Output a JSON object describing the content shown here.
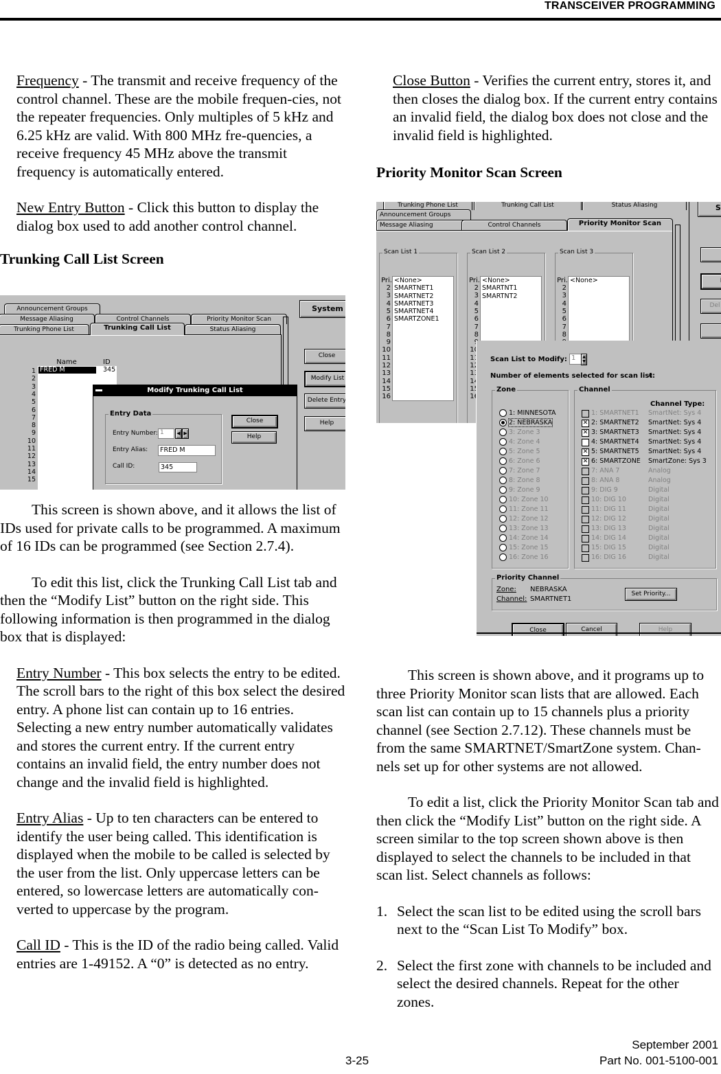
{
  "header": {
    "title": "TRANSCEIVER PROGRAMMING"
  },
  "left": {
    "frequency": {
      "term": "Frequency",
      "text": " - The transmit and receive frequency of the control channel. These are the mobile frequen-cies, not the repeater frequencies. Only multiples of 5 kHz and 6.25 kHz are valid. With 800 MHz fre-quencies, a receive frequency 45 MHz above the transmit frequency is automatically entered."
    },
    "new_entry": {
      "term": "New Entry Button",
      "text": " - Click this button to display the dialog box used to add another control channel."
    },
    "heading": "Trunking Call List Screen",
    "para1": "This screen is shown above, and it allows the list of IDs used for private calls to be programmed. A maximum of 16 IDs can be programmed (see Section 2.7.4).",
    "para2": "To edit this list, click the Trunking Call List tab and then the “Modify List” button on the right side. This following information is then programmed in the dialog box that is displayed:",
    "entry_number": {
      "term": "Entry Number",
      "text": " - This box selects the entry to be edited. The scroll bars to the right of this box select the desired entry. A phone list can contain up to 16 entries. Selecting a new entry number automatically validates and stores the current entry. If the current entry contains an invalid field, the entry number does not change and the invalid field is highlighted."
    },
    "entry_alias": {
      "term": "Entry Alias",
      "text": " - Up to ten characters can be entered to identify the user being called. This identification is displayed when the mobile to be called is selected by the user from the list. Only uppercase letters can be entered, so lowercase letters are automatically con-verted to uppercase by the program."
    },
    "call_id": {
      "term": "Call ID",
      "text": " - This is the ID of the radio being called. Valid entries are 1-49152. A “0” is detected as no entry."
    }
  },
  "right": {
    "close_button": {
      "term": "Close Button",
      "text": " - Verifies the current entry, stores it, and then closes the dialog box. If the current entry contains an invalid field, the dialog box does not close and the invalid field is highlighted."
    },
    "heading": "Priority Monitor Scan Screen",
    "para1": "This screen is shown above, and it programs up to three Priority Monitor scan lists that are allowed. Each scan list can contain up to 15 channels plus a priority channel (see Section 2.7.12). These channels must be from the same SMARTNET/SmartZone system. Chan-nels set up for other systems are not allowed.",
    "para2": "To edit a list, click the Priority Monitor Scan tab and then click the “Modify List” button on the right side. A screen similar to the top screen shown above is then displayed to select the channels to be included in that scan list. Select channels as follows:",
    "steps": [
      {
        "n": "1.",
        "text": "Select the scan list to be edited using the scroll bars next to the “Scan List To Modify” box."
      },
      {
        "n": "2.",
        "text": "Select the first zone with channels to be included and select the desired channels. Repeat for the other zones."
      }
    ]
  },
  "footer": {
    "page": "3-25",
    "date": "September 2001",
    "part": "Part No. 001-5100-001"
  },
  "shot1": {
    "tabs_row1": [
      "Announcement Groups"
    ],
    "tabs_row2": [
      "Message Aliasing",
      "Control Channels",
      "Priority Monitor Scan"
    ],
    "tabs_row3": [
      "Trunking Phone List",
      "Trunking Call List",
      "Status Aliasing"
    ],
    "system_button": "System",
    "col_name": "Name",
    "col_id": "ID",
    "row_numbers": [
      "1",
      "2",
      "3",
      "4",
      "5",
      "6",
      "7",
      "8",
      "9",
      "10",
      "11",
      "12",
      "13",
      "14",
      "15"
    ],
    "first_name": "FRED M",
    "first_id": "345",
    "side_buttons": [
      "Close",
      "Modify List",
      "Delete Entry",
      "Help"
    ],
    "dialog": {
      "title": "Modify Trunking Call List",
      "group": "Entry Data",
      "entry_number_label": "Entry Number:",
      "entry_number_value": "1",
      "entry_alias_label": "Entry Alias:",
      "entry_alias_value": "FRED M",
      "call_id_label": "Call ID:",
      "call_id_value": "345",
      "close": "Close",
      "help": "Help"
    }
  },
  "shot2": {
    "tabs_row1": [
      "Trunking Phone List",
      "Trunking Call List",
      "Status Aliasing"
    ],
    "tabs_row2": [
      "Announcement Groups"
    ],
    "tabs_row3": [
      "Message Aliasing",
      "Control Channels",
      "Priority Monitor Scan"
    ],
    "system_button": "Sy",
    "scan_lists": [
      {
        "title": "Scan List 1",
        "pri": "Pri.",
        "items": [
          "<None>",
          "SMARTNET1",
          "SMARTNET2",
          "SMARTNET3",
          "SMARTNET4",
          "SMARTZONE1"
        ]
      },
      {
        "title": "Scan List 2",
        "pri": "Pri.",
        "items": [
          "<None>",
          "SMARTNT1",
          "SMARTNT2"
        ]
      },
      {
        "title": "Scan List 3",
        "pri": "Pri.",
        "items": [
          "<None>"
        ]
      }
    ],
    "row_numbers": [
      "2",
      "3",
      "4",
      "5",
      "6",
      "7",
      "8",
      "9",
      "10",
      "11",
      "12",
      "13",
      "14",
      "15",
      "16"
    ],
    "side_buttons": [
      "",
      "Mo",
      "Del",
      ""
    ],
    "dialog": {
      "scan_list_label": "Scan List to Modify:",
      "scan_list_value": "1",
      "count_label": "Number of elements selected for scan list:",
      "count_value": "4",
      "zone_group": "Zone",
      "channel_group": "Channel",
      "channel_type_header": "Channel Type:",
      "zones": [
        {
          "label": "1:  MINNESOTA",
          "selected": false,
          "enabled": true
        },
        {
          "label": "2:  NEBRASKA",
          "selected": true,
          "enabled": true
        },
        {
          "label": "3:  Zone 3",
          "selected": false,
          "enabled": false
        },
        {
          "label": "4:  Zone 4",
          "selected": false,
          "enabled": false
        },
        {
          "label": "5:  Zone 5",
          "selected": false,
          "enabled": false
        },
        {
          "label": "6:  Zone 6",
          "selected": false,
          "enabled": false
        },
        {
          "label": "7:  Zone 7",
          "selected": false,
          "enabled": false
        },
        {
          "label": "8:  Zone 8",
          "selected": false,
          "enabled": false
        },
        {
          "label": "9:  Zone 9",
          "selected": false,
          "enabled": false
        },
        {
          "label": "10:  Zone 10",
          "selected": false,
          "enabled": false
        },
        {
          "label": "11:  Zone 11",
          "selected": false,
          "enabled": false
        },
        {
          "label": "12:  Zone 12",
          "selected": false,
          "enabled": false
        },
        {
          "label": "13:  Zone 13",
          "selected": false,
          "enabled": false
        },
        {
          "label": "14:  Zone 14",
          "selected": false,
          "enabled": false
        },
        {
          "label": "15:  Zone 15",
          "selected": false,
          "enabled": false
        },
        {
          "label": "16:  Zone 16",
          "selected": false,
          "enabled": false
        }
      ],
      "channels": [
        {
          "label": "1:  SMARTNET1",
          "type": "SmartNet:  Sys 4",
          "checked": false,
          "enabled": false
        },
        {
          "label": "2:  SMARTNET2",
          "type": "SmartNet:  Sys 4",
          "checked": true,
          "enabled": true
        },
        {
          "label": "3:  SMARTNET3",
          "type": "SmartNet:  Sys 4",
          "checked": true,
          "enabled": true
        },
        {
          "label": "4:  SMARTNET4",
          "type": "SmartNet:  Sys 4",
          "checked": false,
          "enabled": true
        },
        {
          "label": "5:  SMARTNET5",
          "type": "SmartNet:  Sys 4",
          "checked": true,
          "enabled": true
        },
        {
          "label": "6:  SMARTZONE",
          "type": "SmartZone:  Sys 3",
          "checked": true,
          "enabled": true
        },
        {
          "label": "7:  ANA 7",
          "type": "Analog",
          "checked": false,
          "enabled": false
        },
        {
          "label": "8:  ANA 8",
          "type": "Analog",
          "checked": false,
          "enabled": false
        },
        {
          "label": "9:  DIG 9",
          "type": "Digital",
          "checked": false,
          "enabled": false
        },
        {
          "label": "10:  DIG 10",
          "type": "Digital",
          "checked": false,
          "enabled": false
        },
        {
          "label": "11:  DIG 11",
          "type": "Digital",
          "checked": false,
          "enabled": false
        },
        {
          "label": "12:  DIG 12",
          "type": "Digital",
          "checked": false,
          "enabled": false
        },
        {
          "label": "13:  DIG 13",
          "type": "Digital",
          "checked": false,
          "enabled": false
        },
        {
          "label": "14:  DIG 14",
          "type": "Digital",
          "checked": false,
          "enabled": false
        },
        {
          "label": "15:  DIG 15",
          "type": "Digital",
          "checked": false,
          "enabled": false
        },
        {
          "label": "16:  DIG 16",
          "type": "Digital",
          "checked": false,
          "enabled": false
        }
      ],
      "priority_group": "Priority Channel",
      "zone_label": "Zone:",
      "zone_value": "NEBRASKA",
      "channel_label": "Channel:",
      "channel_value": "SMARTNET1",
      "set_priority": "Set Priority...",
      "close": "Close",
      "cancel": "Cancel",
      "help": "Help"
    }
  }
}
